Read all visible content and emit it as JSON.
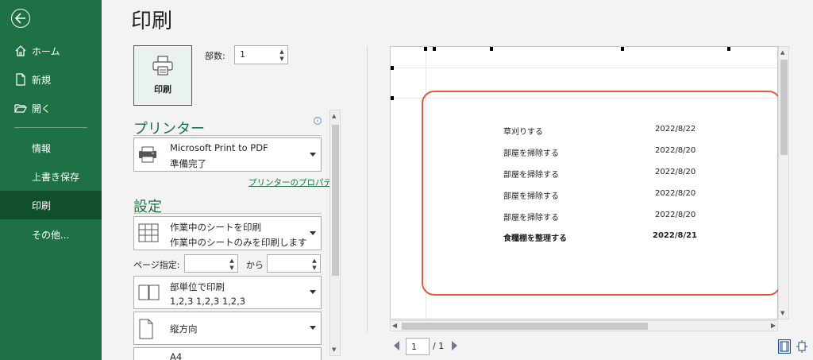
{
  "sidebar": {
    "items": [
      {
        "label": "ホーム",
        "icon": "home-icon"
      },
      {
        "label": "新規",
        "icon": "new-file-icon"
      },
      {
        "label": "開く",
        "icon": "open-folder-icon"
      },
      {
        "label": "情報"
      },
      {
        "label": "上書き保存"
      },
      {
        "label": "印刷"
      },
      {
        "label": "その他..."
      }
    ],
    "active": "印刷"
  },
  "page_title": "印刷",
  "print_button_label": "印刷",
  "copies": {
    "label": "部数:",
    "value": "1"
  },
  "printer": {
    "section_title": "プリンター",
    "name": "Microsoft Print to PDF",
    "status": "準備完了",
    "properties_link": "プリンターのプロパティ"
  },
  "settings": {
    "section_title": "設定",
    "scope": {
      "line1": "作業中のシートを印刷",
      "line2": "作業中のシートのみを印刷します"
    },
    "pages": {
      "label": "ページ指定:",
      "to_label": "から"
    },
    "collate": {
      "line1": "部単位で印刷",
      "line2": "1,2,3    1,2,3    1,2,3"
    },
    "orientation": {
      "line1": "縦方向"
    },
    "paper": {
      "line1": "A4"
    }
  },
  "preview": {
    "rows": [
      {
        "task": "草刈りする",
        "date": "2022/8/22",
        "bold": false
      },
      {
        "task": "部屋を掃除する",
        "date": "2022/8/20",
        "bold": false
      },
      {
        "task": "部屋を掃除する",
        "date": "2022/8/20",
        "bold": false
      },
      {
        "task": "部屋を掃除する",
        "date": "2022/8/20",
        "bold": false
      },
      {
        "task": "部屋を掃除する",
        "date": "2022/8/20",
        "bold": false
      },
      {
        "task": "食糧棚を整理する",
        "date": "2022/8/21",
        "bold": true
      }
    ],
    "highlight_color": "#e05a3c"
  },
  "page_nav": {
    "current": "1",
    "total": "/ 1"
  },
  "colors": {
    "sidebar": "#1e7145",
    "sidebar_active": "#104e2c",
    "accent": "#1e7145"
  }
}
